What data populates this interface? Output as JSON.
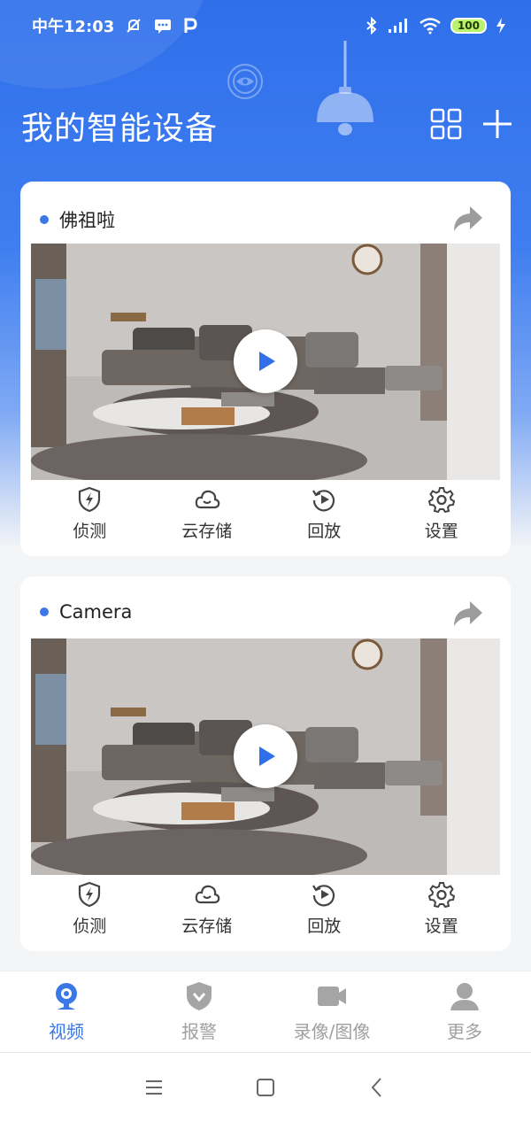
{
  "status_bar": {
    "time": "中午12:03",
    "battery": "100"
  },
  "header": {
    "title": "我的智能设备"
  },
  "devices": [
    {
      "name": "佛祖啦"
    },
    {
      "name": "Camera"
    }
  ],
  "card_actions": {
    "detect": "侦测",
    "cloud": "云存储",
    "playback": "回放",
    "settings": "设置"
  },
  "bottom_nav": [
    {
      "label": "视频",
      "active": true
    },
    {
      "label": "报警",
      "active": false
    },
    {
      "label": "录像/图像",
      "active": false
    },
    {
      "label": "更多",
      "active": false
    }
  ],
  "colors": {
    "accent": "#3a78e6",
    "hero": "#3f7ef0",
    "inactive": "#a0a0a0"
  }
}
